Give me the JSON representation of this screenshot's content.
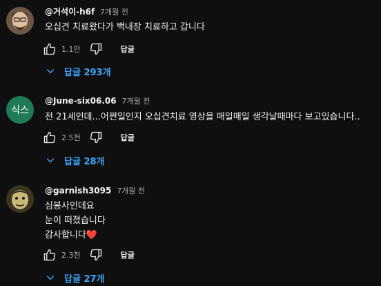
{
  "comments": [
    {
      "author": "@거석이-h6f",
      "time": "7개월 전",
      "lines": [
        "오십견 치료왔다가 백내장 치료하고 갑니다"
      ],
      "likes": "1.1만",
      "reply_label": "답글",
      "replies_label": "답글 293개",
      "avatar": "avatar-photo"
    },
    {
      "author": "@June-six06.06",
      "time": "7개월 전",
      "lines": [
        "전 21세인데...어쩐일인지 오십견치료 영상을 매일매일 생각날때마다 보고있습니다.."
      ],
      "likes": "2.5천",
      "reply_label": "답글",
      "replies_label": "답글 28개",
      "avatar_text": "식스",
      "avatar_color": "#1e7a57"
    },
    {
      "author": "@garnish3095",
      "time": "7개월 전",
      "lines": [
        "심봉사인데요",
        "눈이 떠졌습니다",
        "감사합니다"
      ],
      "heart": "❤️",
      "likes": "2.3천",
      "reply_label": "답글",
      "replies_label": "답글 27개",
      "avatar": "avatar-photo"
    }
  ],
  "colors": {
    "background": "#0f0f0f",
    "text": "#f1f1f1",
    "secondary": "#aaaaaa",
    "link": "#3ea6ff",
    "heart": "#e2133a"
  }
}
